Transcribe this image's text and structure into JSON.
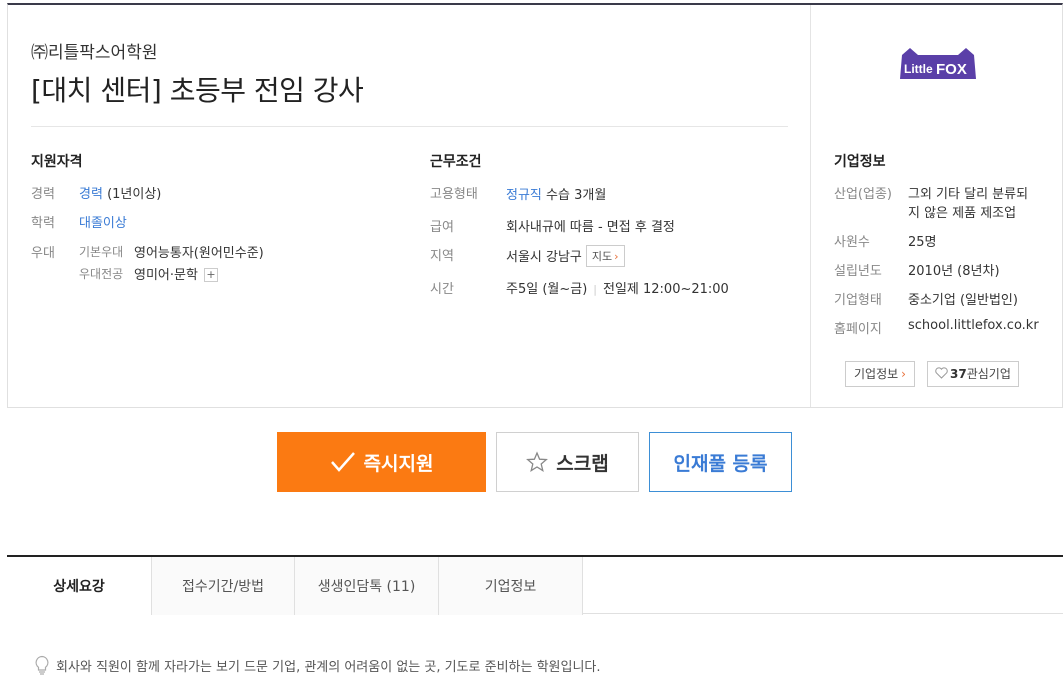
{
  "header": {
    "company": "㈜리틀팍스어학원",
    "title": "[대치 센터] 초등부 전임 강사"
  },
  "qualification": {
    "heading": "지원자격",
    "career_label": "경력",
    "career_value": "경력",
    "career_detail": "(1년이상)",
    "education_label": "학력",
    "education_value": "대졸이상",
    "preference_label": "우대",
    "basic_pref_label": "기본우대",
    "basic_pref_value": "영어능통자(원어민수준)",
    "major_pref_label": "우대전공",
    "major_pref_value": "영미어·문학",
    "plus": "+"
  },
  "conditions": {
    "heading": "근무조건",
    "employment_label": "고용형태",
    "employment_value": "정규직",
    "employment_detail": "수습 3개월",
    "salary_label": "급여",
    "salary_value": "회사내규에 따름 - 면접 후 결정",
    "location_label": "지역",
    "location_value": "서울시 강남구",
    "map_button": "지도",
    "time_label": "시간",
    "time_days": "주5일 (월~금)",
    "time_hours": "전일제 12:00~21:00"
  },
  "company_info": {
    "logo_text_1": "Little",
    "logo_text_2": "FOX",
    "heading": "기업정보",
    "industry_label": "산업(업종)",
    "industry_value_1": "그외 기타 달리 분류되",
    "industry_value_2": "지 않은 제품 제조업",
    "employees_label": "사원수",
    "employees_value": "25명",
    "founded_label": "설립년도",
    "founded_value": "2010년 (8년차)",
    "type_label": "기업형태",
    "type_value": "중소기업 (일반법인)",
    "homepage_label": "홈페이지",
    "homepage_value": "school.littlefox.co.kr",
    "info_button": "기업정보",
    "interest_count": "37",
    "interest_label": "관심기업"
  },
  "actions": {
    "apply": "즉시지원",
    "scrap": "스크랩",
    "talent_pool": "인재풀 등록"
  },
  "tabs": [
    {
      "label": "상세요강",
      "active": true
    },
    {
      "label": "접수기간/방법",
      "active": false
    },
    {
      "label": "생생인담톡 (11)",
      "active": false
    },
    {
      "label": "기업정보",
      "active": false
    }
  ],
  "intro": "회사와 직원이 함께 자라가는 보기 드문 기업, 관계의 어려움이 없는 곳, 기도로 준비하는 학원입니다.",
  "colors": {
    "accent_orange": "#fb7a12",
    "link_blue": "#3a7bd5",
    "logo_purple": "#5a3fa8"
  }
}
